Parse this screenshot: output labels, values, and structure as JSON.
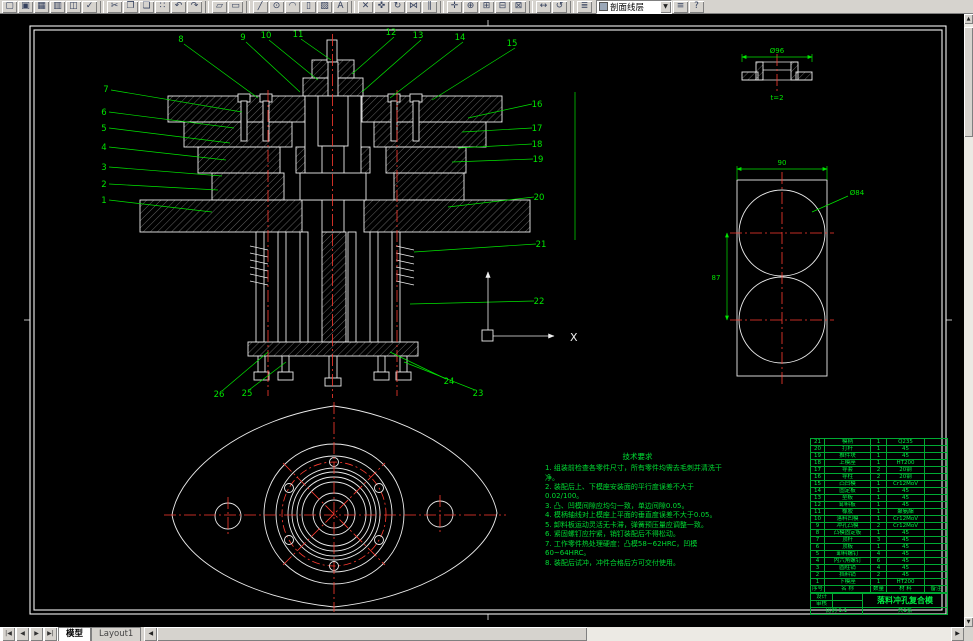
{
  "toolbar": {
    "glyphs": {
      "new": "▢",
      "open": "▣",
      "save": "▦",
      "plot": "▥",
      "preview": "◫",
      "spell": "✓",
      "cut": "✂",
      "copy": "❐",
      "paste": "❏",
      "match": "∷",
      "undo": "↶",
      "redo": "↷",
      "insert": "▱",
      "xref": "▭",
      "line": "╱",
      "circle": "⊙",
      "arc": "◠",
      "rect": "▯",
      "hatch": "▨",
      "text": "A",
      "erase": "✕",
      "move": "✜",
      "rotate": "↻",
      "mirror": "⋈",
      "offset": "∥",
      "pan": "✛",
      "zoom_rt": "⊕",
      "zoom_win": "⊞",
      "zoom_prev": "⊟",
      "zoom_ext": "⊠",
      "dist": "↔",
      "redraw": "↺",
      "layers": "≣",
      "props": "≡",
      "help": "?"
    },
    "layer_combo": {
      "value": "剖面线层",
      "arrow": "▼"
    }
  },
  "canvas": {
    "balloons": [
      "1",
      "2",
      "3",
      "4",
      "5",
      "6",
      "7",
      "8",
      "9",
      "10",
      "11",
      "12",
      "13",
      "14",
      "15",
      "16",
      "17",
      "18",
      "19",
      "20",
      "21",
      "22",
      "23",
      "24",
      "25",
      "26"
    ],
    "ucs": {
      "x_label": "X"
    },
    "detail": {
      "dim_top": "Ø96",
      "thickness": "t=2"
    },
    "strip": {
      "width": "90",
      "pitch": "87",
      "dia": "Ø84"
    },
    "notes": {
      "title": "技术要求",
      "lines": [
        "1. 组装前检查各零件尺寸，所有零件均需去毛刺并清洗干净。",
        "2. 装配后上、下模座安装面的平行度误差不大于0.02/100。",
        "3. 凸、凹模间隙应均匀一致，单边间隙0.05。",
        "4. 模柄轴线对上模座上平面的垂直度误差不大于0.05。",
        "5. 卸料板运动灵活无卡滞，弹簧预压量应调整一致。",
        "6. 紧固螺钉应拧紧，销钉装配后不得松动。",
        "7. 工作零件热处理硬度：凸模58~62HRC，凹模60~64HRC。",
        "8. 装配后试冲，冲件合格后方可交付使用。"
      ]
    },
    "bom": {
      "columns": [
        "序号",
        "名 称",
        "数量",
        "材 料",
        "备注"
      ],
      "rows": [
        [
          "21",
          "模柄",
          "1",
          "Q235",
          ""
        ],
        [
          "20",
          "打杆",
          "1",
          "45",
          ""
        ],
        [
          "19",
          "推件块",
          "1",
          "45",
          ""
        ],
        [
          "18",
          "上模座",
          "1",
          "HT200",
          ""
        ],
        [
          "17",
          "导套",
          "2",
          "20钢",
          ""
        ],
        [
          "16",
          "导柱",
          "2",
          "20钢",
          ""
        ],
        [
          "15",
          "凸凹模",
          "1",
          "Cr12MoV",
          ""
        ],
        [
          "14",
          "固定板",
          "1",
          "45",
          ""
        ],
        [
          "13",
          "垫板",
          "1",
          "45",
          ""
        ],
        [
          "12",
          "卸料板",
          "1",
          "45",
          ""
        ],
        [
          "11",
          "橡胶",
          "1",
          "聚氨酯",
          ""
        ],
        [
          "10",
          "落料凹模",
          "1",
          "Cr12MoV",
          ""
        ],
        [
          "9",
          "冲孔凸模",
          "2",
          "Cr12MoV",
          ""
        ],
        [
          "8",
          "凸模固定板",
          "1",
          "45",
          ""
        ],
        [
          "7",
          "顶杆",
          "3",
          "45",
          ""
        ],
        [
          "6",
          "顶板",
          "1",
          "45",
          ""
        ],
        [
          "5",
          "卸料螺钉",
          "4",
          "45",
          ""
        ],
        [
          "4",
          "内六角螺钉",
          "6",
          "45",
          ""
        ],
        [
          "3",
          "圆柱销",
          "4",
          "45",
          ""
        ],
        [
          "2",
          "挡料销",
          "2",
          "45",
          ""
        ],
        [
          "1",
          "下模座",
          "1",
          "HT200",
          ""
        ]
      ],
      "title_block": {
        "design": "设计",
        "check": "审核",
        "title": "落料冲孔复合模",
        "scale": "比例 1:1",
        "sheet": "共1张"
      }
    }
  },
  "tabs": {
    "nav": [
      "|◀",
      "◀",
      "▶",
      "▶|"
    ],
    "model": "模型",
    "layout1": "Layout1"
  },
  "scroll": {
    "up": "▲",
    "down": "▼",
    "left": "◀",
    "right": "▶"
  }
}
